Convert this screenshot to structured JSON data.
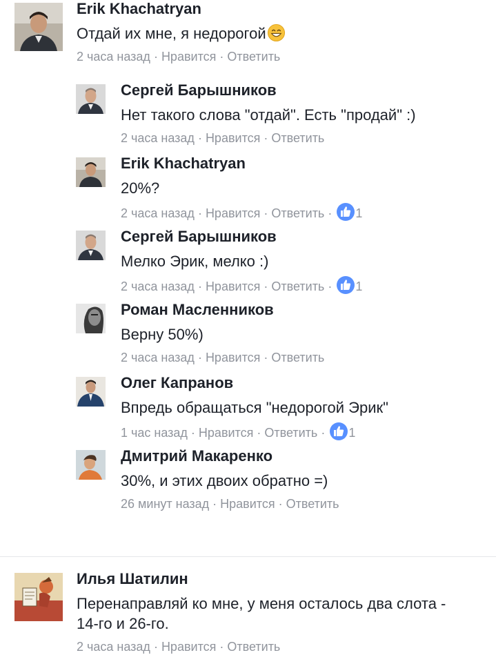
{
  "comments": [
    {
      "author": "Erik Khachatryan",
      "text": "Отдай их мне, я недорогой",
      "emoji": "grinning-face-emoji",
      "time": "2 часа назад",
      "like": "Нравится",
      "reply": "Ответить",
      "replies": [
        {
          "author": "Сергей Барышников",
          "text": "Нет такого слова \"отдай\". Есть \"продай\" :)",
          "time": "2 часа назад",
          "like": "Нравится",
          "reply": "Ответить",
          "likes": null
        },
        {
          "author": "Erik Khachatryan",
          "text": "20%?",
          "time": "2 часа назад",
          "like": "Нравится",
          "reply": "Ответить",
          "likes": "1"
        },
        {
          "author": "Сергей Барышников",
          "text": "Мелко Эрик, мелко :)",
          "time": "2 часа назад",
          "like": "Нравится",
          "reply": "Ответить",
          "likes": "1"
        },
        {
          "author": "Роман Масленников",
          "text": "Верну 50%)",
          "time": "2 часа назад",
          "like": "Нравится",
          "reply": "Ответить",
          "likes": null
        },
        {
          "author": "Олег Капранов",
          "text": "Впредь обращаться \"недорогой Эрик\"",
          "time": "1 час назад",
          "like": "Нравится",
          "reply": "Ответить",
          "likes": "1"
        },
        {
          "author": "Дмитрий Макаренко",
          "text": "30%, и этих двоих обратно =)",
          "time": "26 минут назад",
          "like": "Нравится",
          "reply": "Ответить",
          "likes": null
        }
      ]
    },
    {
      "author": "Илья Шатилин",
      "text": "Перенаправляй ко мне, у меня осталось два слота - 14-го и 26-го.",
      "time": "2 часа назад",
      "like": "Нравится",
      "reply": "Ответить"
    }
  ],
  "colors": {
    "text": "#1d2129",
    "meta": "#90949c",
    "like_badge": "#5890ff"
  }
}
